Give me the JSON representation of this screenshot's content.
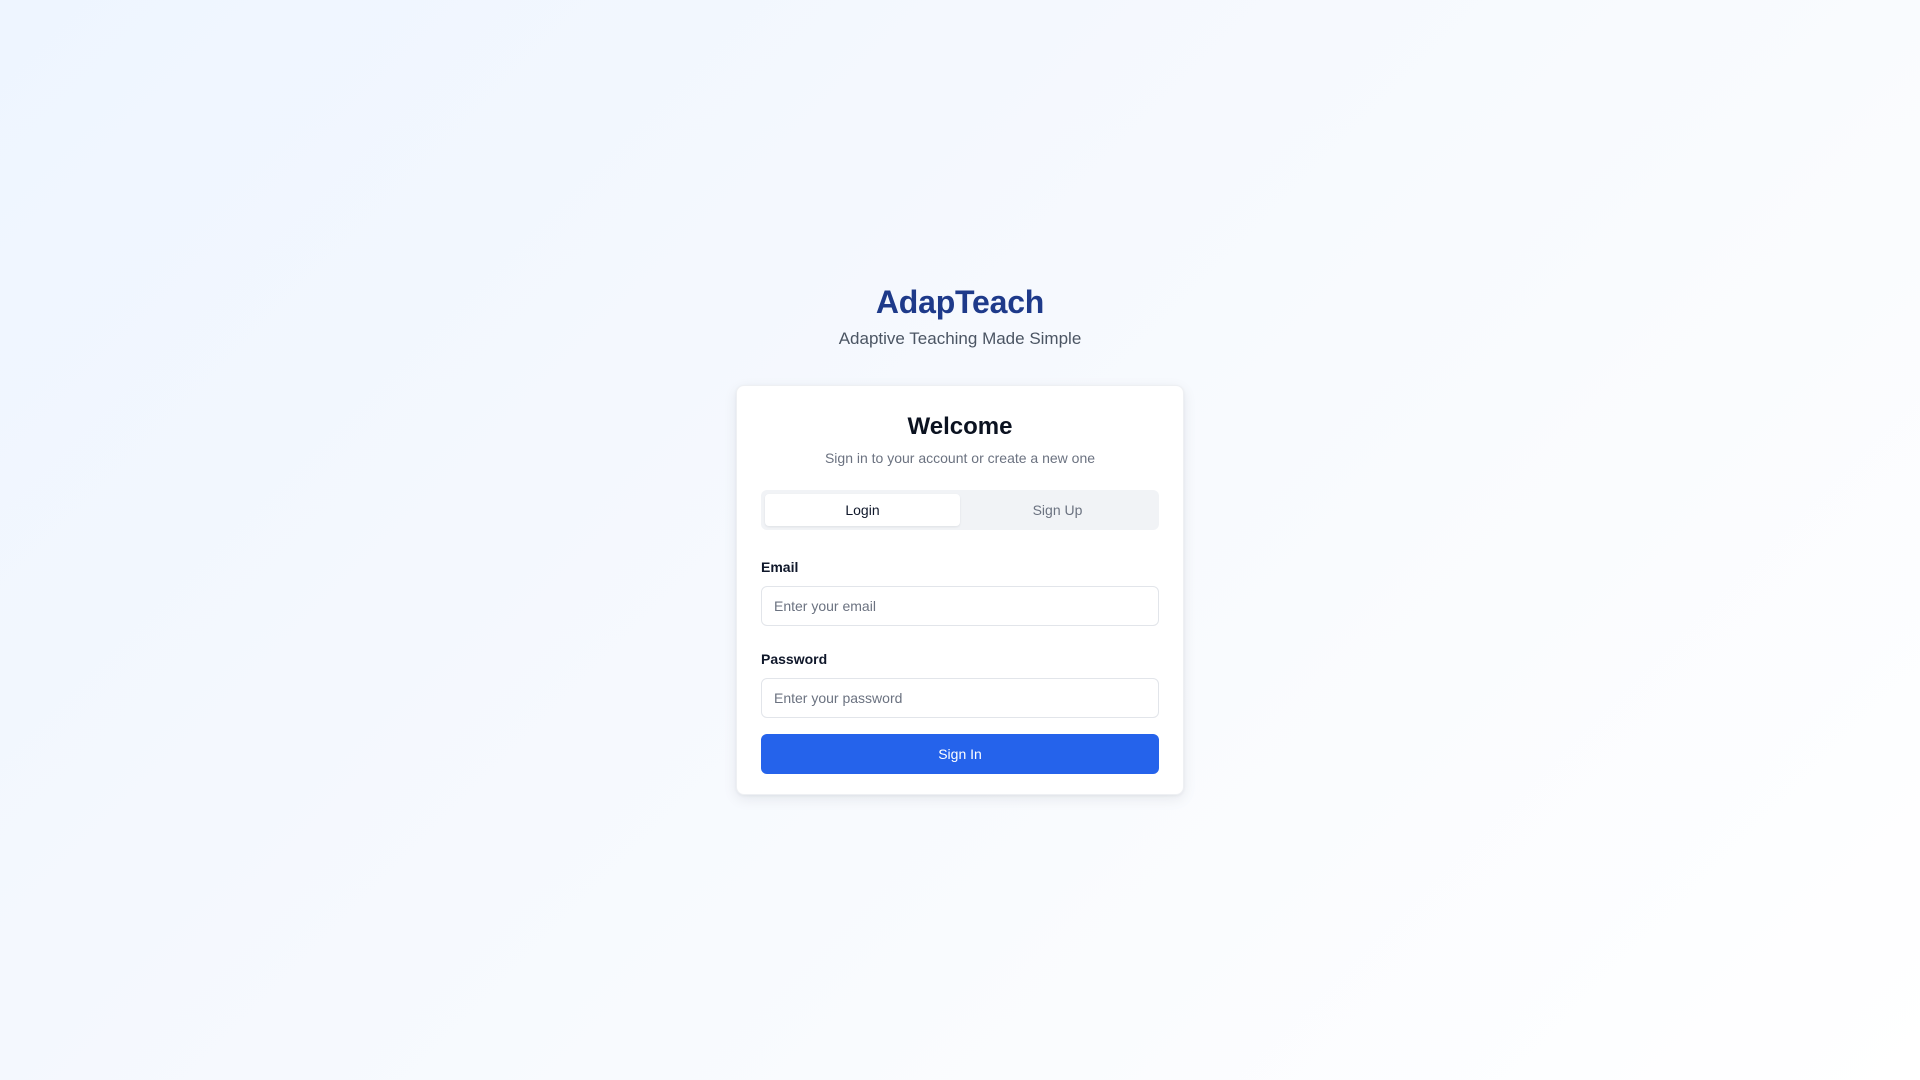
{
  "brand": {
    "title": "AdapTeach",
    "tagline": "Adaptive Teaching Made Simple"
  },
  "card": {
    "title": "Welcome",
    "subtitle": "Sign in to your account or create a new one"
  },
  "tabs": [
    {
      "label": "Login",
      "active": true
    },
    {
      "label": "Sign Up",
      "active": false
    }
  ],
  "form": {
    "email_label": "Email",
    "email_placeholder": "Enter your email",
    "email_value": "",
    "password_label": "Password",
    "password_placeholder": "Enter your password",
    "password_value": "",
    "submit_label": "Sign In"
  },
  "colors": {
    "brand": "#1e3a8a",
    "primary": "#2563eb",
    "muted": "#6b7280"
  }
}
